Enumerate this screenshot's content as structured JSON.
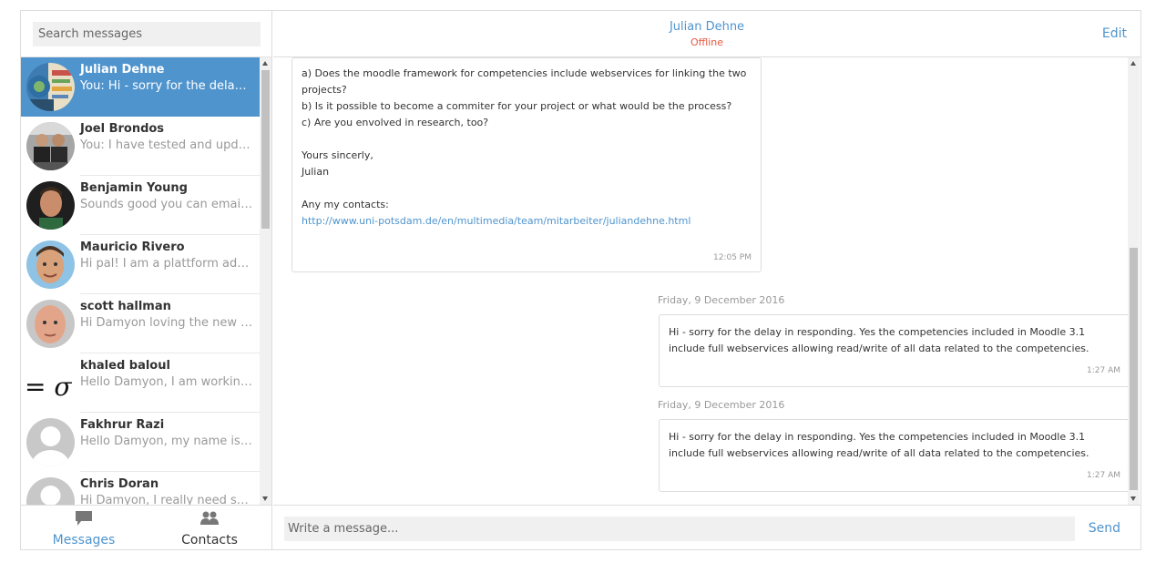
{
  "search": {
    "placeholder": "Search messages"
  },
  "conversations": [
    {
      "name": "Julian Dehne",
      "preview": "You: Hi - sorry for the delay in responding.",
      "avatar": "avatar-julian"
    },
    {
      "name": "Joel Brondos",
      "preview": "You: I have tested and updated the plugin",
      "avatar": "avatar-joel"
    },
    {
      "name": "Benjamin Young",
      "preview": "Sounds good you can email me",
      "avatar": "avatar-benjamin"
    },
    {
      "name": "Mauricio Rivero",
      "preview": "Hi pal! I am a plattform administrator",
      "avatar": "avatar-mauricio"
    },
    {
      "name": "scott hallman",
      "preview": "Hi Damyon loving the new features",
      "avatar": "avatar-scott"
    },
    {
      "name": "khaled baloul",
      "preview": "Hello Damyon, I am working on a project",
      "avatar": "avatar-khaled"
    },
    {
      "name": "Fakhrur Razi",
      "preview": "Hello Damyon, my name is Fakhrur",
      "avatar": "avatar-default"
    },
    {
      "name": "Chris Doran",
      "preview": "Hi Damyon, I really need some help",
      "avatar": "avatar-default"
    }
  ],
  "footer": {
    "messages_label": "Messages",
    "contacts_label": "Contacts",
    "messages_icon": "speech-bubble-icon",
    "contacts_icon": "people-icon"
  },
  "header": {
    "contact_name": "Julian Dehne",
    "status": "Offline",
    "edit_label": "Edit"
  },
  "messages": {
    "first": {
      "lines": [
        "a) Does the moodle framework for competencies include webservices for linking the two",
        "projects?",
        "b) Is it possible to become a commiter for your project or what would be the process?",
        "c) Are you envolved in research, too?",
        "",
        "Yours sincerly,",
        "Julian",
        "",
        "Any my contacts:"
      ],
      "link": "http://www.uni-potsdam.de/en/multimedia/team/mitarbeiter/juliandehne.html",
      "time": "12:05 PM"
    },
    "day1": "Friday, 9 December 2016",
    "second": {
      "line1": "Hi - sorry for the delay in responding. Yes the competencies included in Moodle 3.1",
      "line2": "include full webservices allowing read/write of all data related to the competencies.",
      "time": "1:27 AM"
    },
    "day2": "Friday, 9 December 2016",
    "third": {
      "line1": "Hi - sorry for the delay in responding. Yes the competencies included in Moodle 3.1",
      "line2": "include full webservices allowing read/write of all data related to the competencies.",
      "time": "1:27 AM"
    }
  },
  "compose": {
    "placeholder": "Write a message...",
    "send_label": "Send"
  },
  "colors": {
    "accent": "#4f94cd",
    "offline": "#e8573f"
  }
}
